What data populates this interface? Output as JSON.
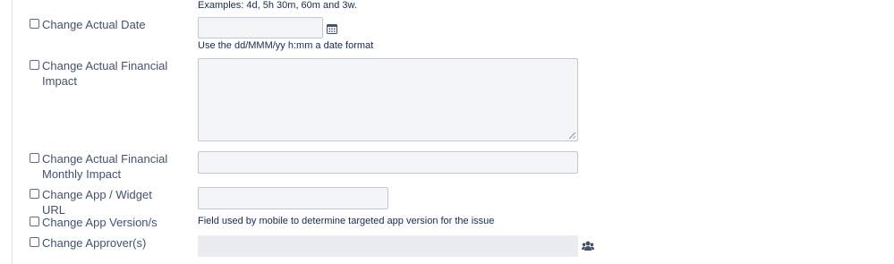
{
  "hints": {
    "duration_examples": "Examples: 4d, 5h 30m, 60m and 3w.",
    "date_format": "Use the dd/MMM/yy h:mm a date format",
    "app_version_desc": "Field used by mobile to determine targeted app version for the issue"
  },
  "fields": {
    "actual_date": {
      "label": "Change Actual Date",
      "value": ""
    },
    "actual_financial_impact": {
      "label": "Change Actual Financial Impact",
      "value": ""
    },
    "actual_financial_monthly_impact": {
      "label": "Change Actual Financial Monthly Impact",
      "value": ""
    },
    "app_widget_url": {
      "label": "Change App / Widget URL",
      "value": ""
    },
    "app_versions": {
      "label": "Change App Version/s"
    },
    "approvers": {
      "label": "Change Approver(s)",
      "value": ""
    }
  },
  "icons": {
    "date_picker": "calendar-icon",
    "user_picker": "users-icon"
  },
  "colors": {
    "field_bg": "#f4f5f7",
    "disabled_bg": "#ebecf0",
    "label_text": "#42526e"
  }
}
